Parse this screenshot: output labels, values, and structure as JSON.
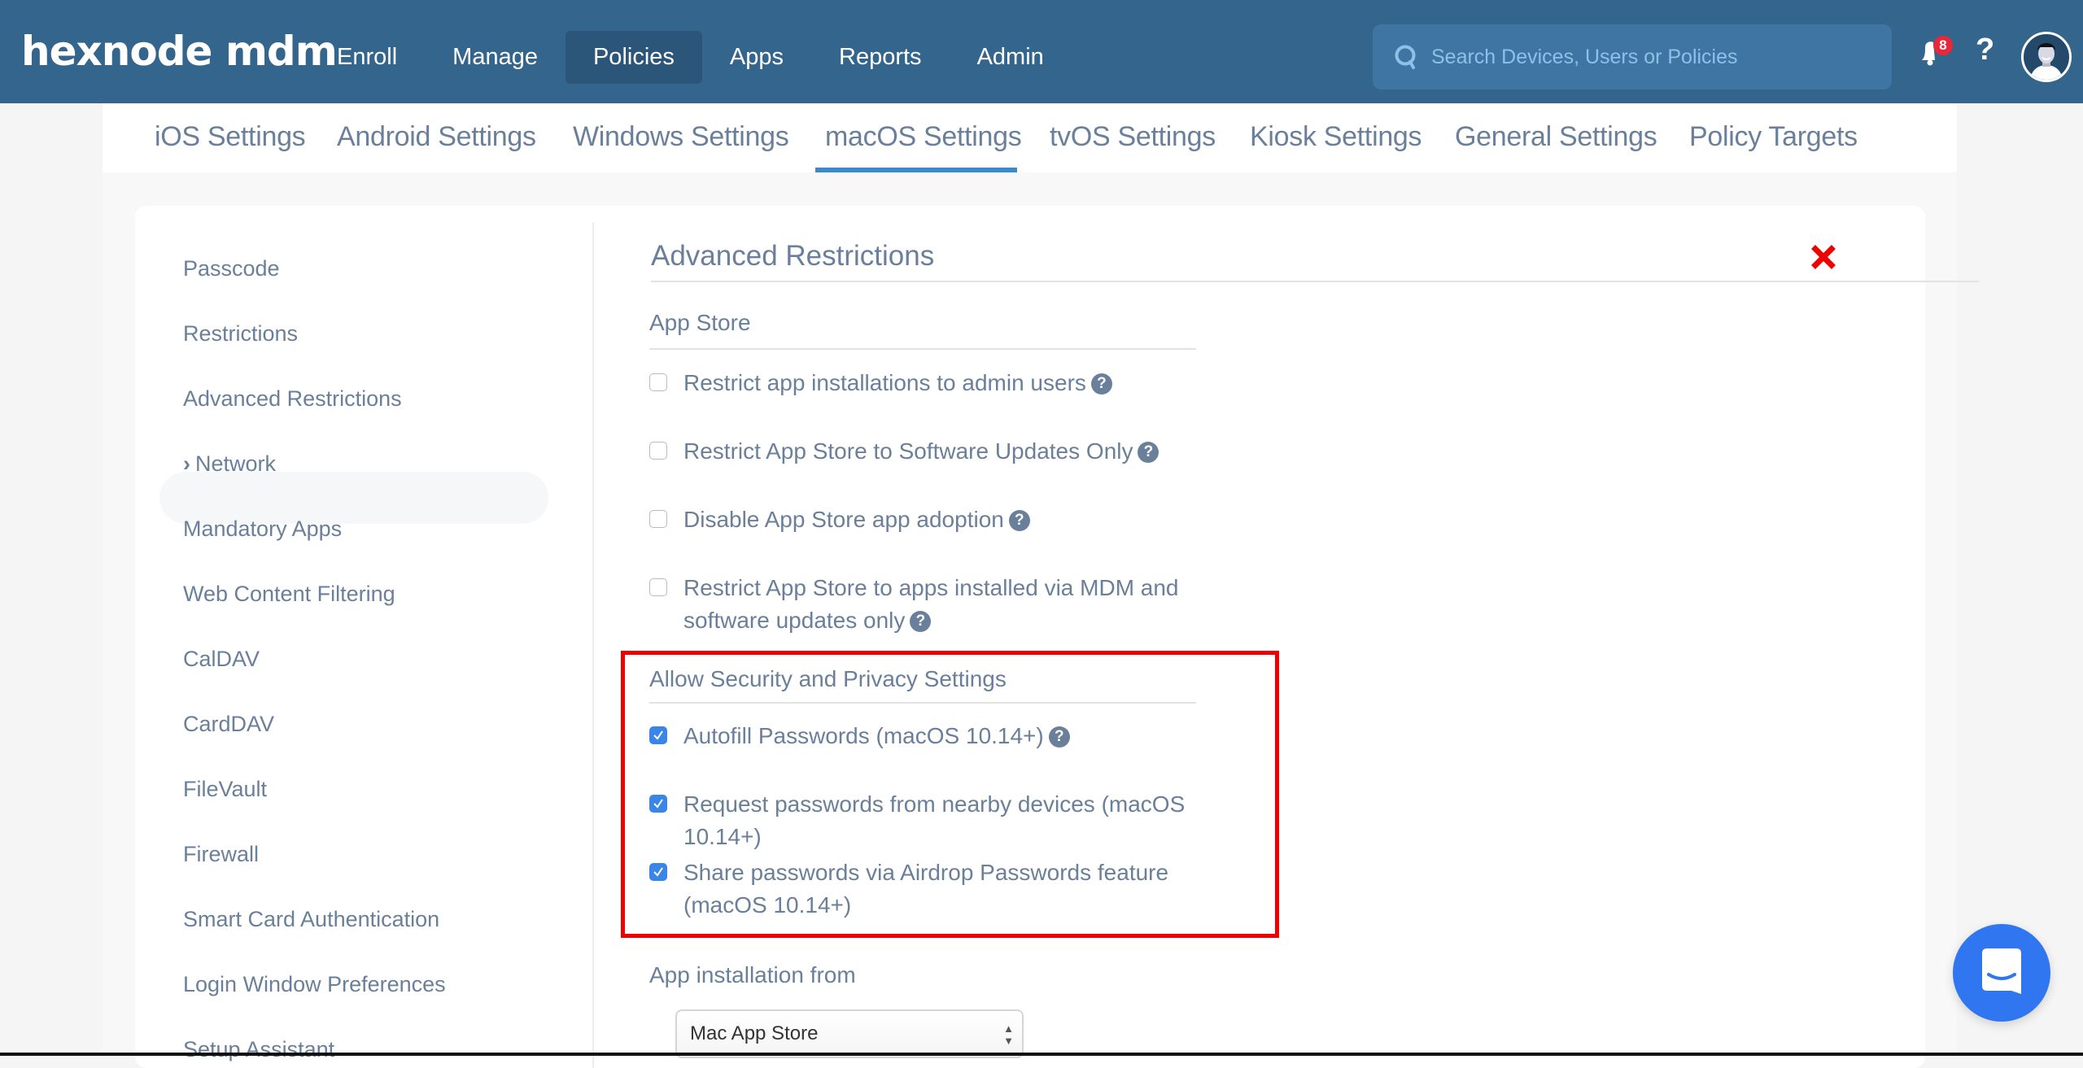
{
  "topbar": {
    "logo": "hexnode mdm",
    "nav": [
      "Enroll",
      "Manage",
      "Policies",
      "Apps",
      "Reports",
      "Admin"
    ],
    "active_nav": "Policies",
    "search_placeholder": "Search Devices, Users or Policies",
    "notification_count": "8",
    "help_label": "?"
  },
  "tabs": [
    "iOS Settings",
    "Android Settings",
    "Windows Settings",
    "macOS Settings",
    "tvOS Settings",
    "Kiosk Settings",
    "General Settings",
    "Policy Targets"
  ],
  "active_tab": "macOS Settings",
  "sidebar": {
    "items": [
      "Passcode",
      "Restrictions",
      "Advanced Restrictions",
      "Network",
      "Mandatory Apps",
      "Web Content Filtering",
      "CalDAV",
      "CardDAV",
      "FileVault",
      "Firewall",
      "Smart Card Authentication",
      "Login Window Preferences",
      "Setup Assistant"
    ],
    "active_item": "Advanced Restrictions",
    "expandable_marker": "›"
  },
  "main": {
    "title": "Advanced Restrictions",
    "groups": [
      {
        "title": "App Store",
        "options": [
          {
            "label": "Restrict app installations to admin users",
            "checked": false,
            "help": true
          },
          {
            "label": "Restrict App Store to Software Updates Only",
            "checked": false,
            "help": true
          },
          {
            "label": "Disable App Store app adoption",
            "checked": false,
            "help": true
          },
          {
            "label": "Restrict App Store to apps installed via MDM and software updates only",
            "checked": false,
            "help": true
          }
        ]
      },
      {
        "title": "Allow Security and Privacy Settings",
        "options": [
          {
            "label": "Autofill Passwords (macOS 10.14+)",
            "checked": true,
            "help": true
          },
          {
            "label": "Request passwords from nearby devices (macOS 10.14+)",
            "checked": true,
            "help": false
          },
          {
            "label": "Share passwords via Airdrop Passwords feature (macOS 10.14+)",
            "checked": true,
            "help": false
          }
        ]
      }
    ],
    "app_installation": {
      "label": "App installation from",
      "selected": "Mac App Store"
    }
  },
  "colors": {
    "topbar": "#34658c",
    "accent": "#3d88c8",
    "checkbox": "#3a86e8",
    "highlight": "#ee0000",
    "text": "#6a7f9a",
    "chat": "#2f76f0"
  }
}
